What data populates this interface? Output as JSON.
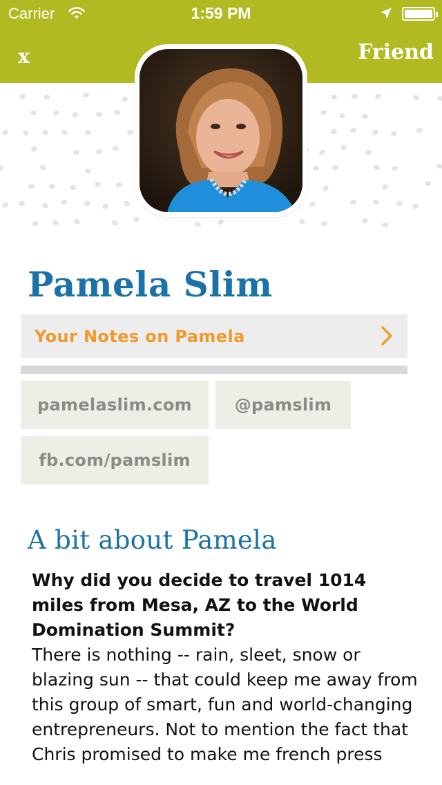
{
  "status_bar": {
    "carrier": "Carrier",
    "time": "1:59 PM"
  },
  "nav": {
    "close_label": "x",
    "friend_label": "Friend",
    "color": "#b1bb21"
  },
  "profile": {
    "name": "Pamela Slim",
    "notes_label": "Your Notes on Pamela",
    "links": {
      "website": "pamelaslim.com",
      "twitter": "@pamslim",
      "facebook": "fb.com/pamslim"
    }
  },
  "about": {
    "title": "A bit about Pamela",
    "question": "Why did you decide to travel 1014 miles from Mesa, AZ to the World Domination Summit?",
    "answer": "There is nothing -- rain, sleet, snow or blazing sun -- that could keep me away from this group of smart, fun and world-changing entrepreneurs. Not to mention the fact that Chris promised to make me french press"
  },
  "colors": {
    "accent_blue": "#1a72a8",
    "accent_orange": "#f09a2b",
    "chip_bg": "#efeee6"
  }
}
